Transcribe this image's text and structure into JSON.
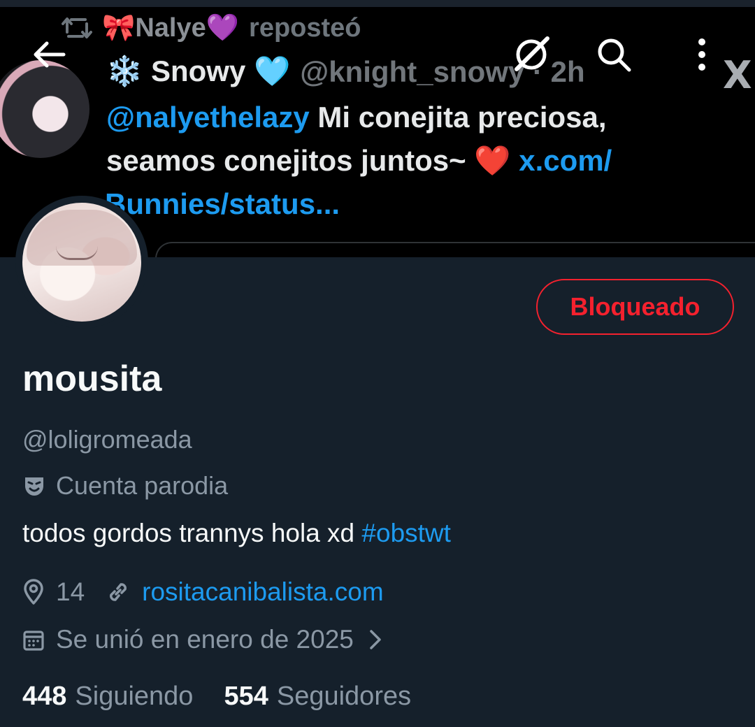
{
  "banner": {
    "repost_name": "🎀Nalye💜",
    "repost_suffix": "reposteó",
    "author_name": "❄️ Snowy 🩵",
    "author_handle": "@knight_snowy · 2h",
    "tweet_mention": "@nalyethelazy",
    "tweet_text_1": " Mi conejita preciosa,",
    "tweet_text_2": "seamos conejitos juntos~ ",
    "tweet_heart": "❤️",
    "tweet_link_1": " x.com/",
    "tweet_link_2": "Bunnies/status..."
  },
  "header": {
    "back_icon": "arrow-left-icon",
    "grok_icon": "grok-icon",
    "search_icon": "search-icon",
    "more_icon": "more-vertical-icon",
    "logo": "X"
  },
  "profile": {
    "display_name": "mousita",
    "username": "@loligromeada",
    "parody_label": "Cuenta parodia",
    "bio_text": "todos gordos trannys hola xd ",
    "bio_hashtag": "#obstwt",
    "location": "14",
    "website": "rositacanibalista.com",
    "joined": "Se unió en enero de 2025",
    "blocked_label": "Bloqueado"
  },
  "stats": {
    "following_count": "448",
    "following_label": "Siguiendo",
    "followers_count": "554",
    "followers_label": "Seguidores"
  },
  "colors": {
    "background": "#15202b",
    "accent": "#1d9bf0",
    "danger": "#f4212e",
    "muted": "#8b98a5"
  }
}
